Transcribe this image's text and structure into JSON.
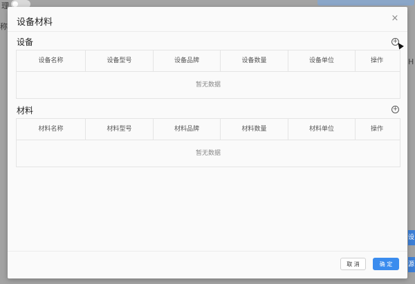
{
  "background": {
    "frag_top_left": "理",
    "frag_left": "称",
    "frag_right_h": "H",
    "side_btn_1": "设",
    "side_btn_2": "源"
  },
  "modal": {
    "title": "设备材料",
    "close_icon": "×",
    "equipment": {
      "title": "设备",
      "columns": [
        "设备名称",
        "设备型号",
        "设备品牌",
        "设备数量",
        "设备单位",
        "操作"
      ],
      "empty_text": "暂无数据"
    },
    "materials": {
      "title": "材料",
      "columns": [
        "材料名称",
        "材料型号",
        "材料品牌",
        "材料数量",
        "材料单位",
        "操作"
      ],
      "empty_text": "暂无数据"
    },
    "footer": {
      "cancel_label": "取 消",
      "ok_label": "确 定"
    }
  },
  "colors": {
    "primary": "#3b8cee",
    "overlay": "#a3a3a3"
  }
}
